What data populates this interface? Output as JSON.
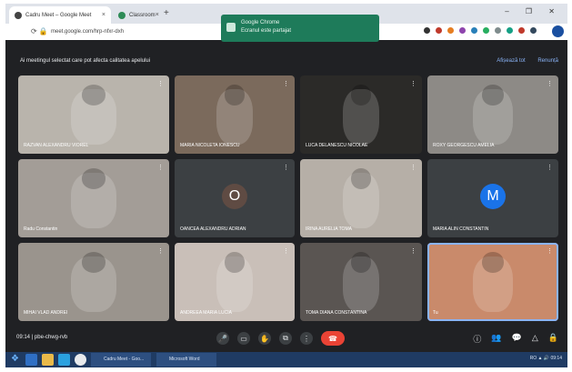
{
  "browser": {
    "tabs": [
      {
        "title": "Cadru Meet – Google Meet",
        "close": "×"
      },
      {
        "title": "Classroom",
        "close": "×"
      }
    ],
    "new_tab": "+",
    "window_controls": "– ❐ ✕",
    "url": "meet.google.com/hrp-nfxr-dxh",
    "nav": "⟳  🔒"
  },
  "toast": {
    "title": "Google Chrome",
    "body": "Ecranul este partajat"
  },
  "meet": {
    "notice": "Ai meetingul selectat care pot afecta calitatea apelului",
    "links": [
      "Afișează tot",
      "Renunță"
    ],
    "more_glyph": "⋮",
    "tiles": [
      {
        "name": "RAZVAN ALEXANDRU VIOREL",
        "kind": "video",
        "bg": "#b9b4ac"
      },
      {
        "name": "MARIA NICOLETA IONESCU",
        "kind": "video",
        "bg": "#7b6a5c"
      },
      {
        "name": "LUCA DELANESCU NICOLAE",
        "kind": "video",
        "bg": "#2b2a28"
      },
      {
        "name": "ROXY GEORGESCU AMELIA",
        "kind": "video",
        "bg": "#8d8a86"
      },
      {
        "name": "Radu Constantin",
        "kind": "video",
        "bg": "#a39d97"
      },
      {
        "name": "OANCEA ALEXANDRU ADRIAN",
        "kind": "avatar",
        "letter": "O",
        "avatar_color": "#5f4b43",
        "bg": "#3c4043"
      },
      {
        "name": "IRINA AURELIA TOMA",
        "kind": "video",
        "bg": "#b6afa7"
      },
      {
        "name": "MARIA ALIN CONSTANTIN",
        "kind": "avatar",
        "letter": "M",
        "avatar_color": "#1a73e8",
        "bg": "#3c4043"
      },
      {
        "name": "MIHAI VLAD ANDREI",
        "kind": "video",
        "bg": "#9a948d"
      },
      {
        "name": "ANDREEA MARIA LUCIA",
        "kind": "video",
        "bg": "#c9bfb8"
      },
      {
        "name": "TOMA DIANA CONSTANTINA",
        "kind": "video",
        "bg": "#5a5552"
      },
      {
        "name": "Tu",
        "kind": "video",
        "bg": "#c98a6b"
      }
    ]
  },
  "controls": {
    "meeting_info": "09:14  |  pbe-chwg-rvb",
    "buttons": [
      "🎤",
      "▭",
      "✋",
      "⧉",
      "⋮"
    ],
    "hangup": "☎",
    "right": [
      "ⓘ",
      "👥",
      "💬",
      "△",
      "🔒"
    ]
  },
  "taskbar": {
    "start": "❖",
    "tasks": [
      "Cadru Meet - Goo...",
      "Microsoft Word"
    ],
    "tray": "RO  ▲  🔊  09:14"
  }
}
